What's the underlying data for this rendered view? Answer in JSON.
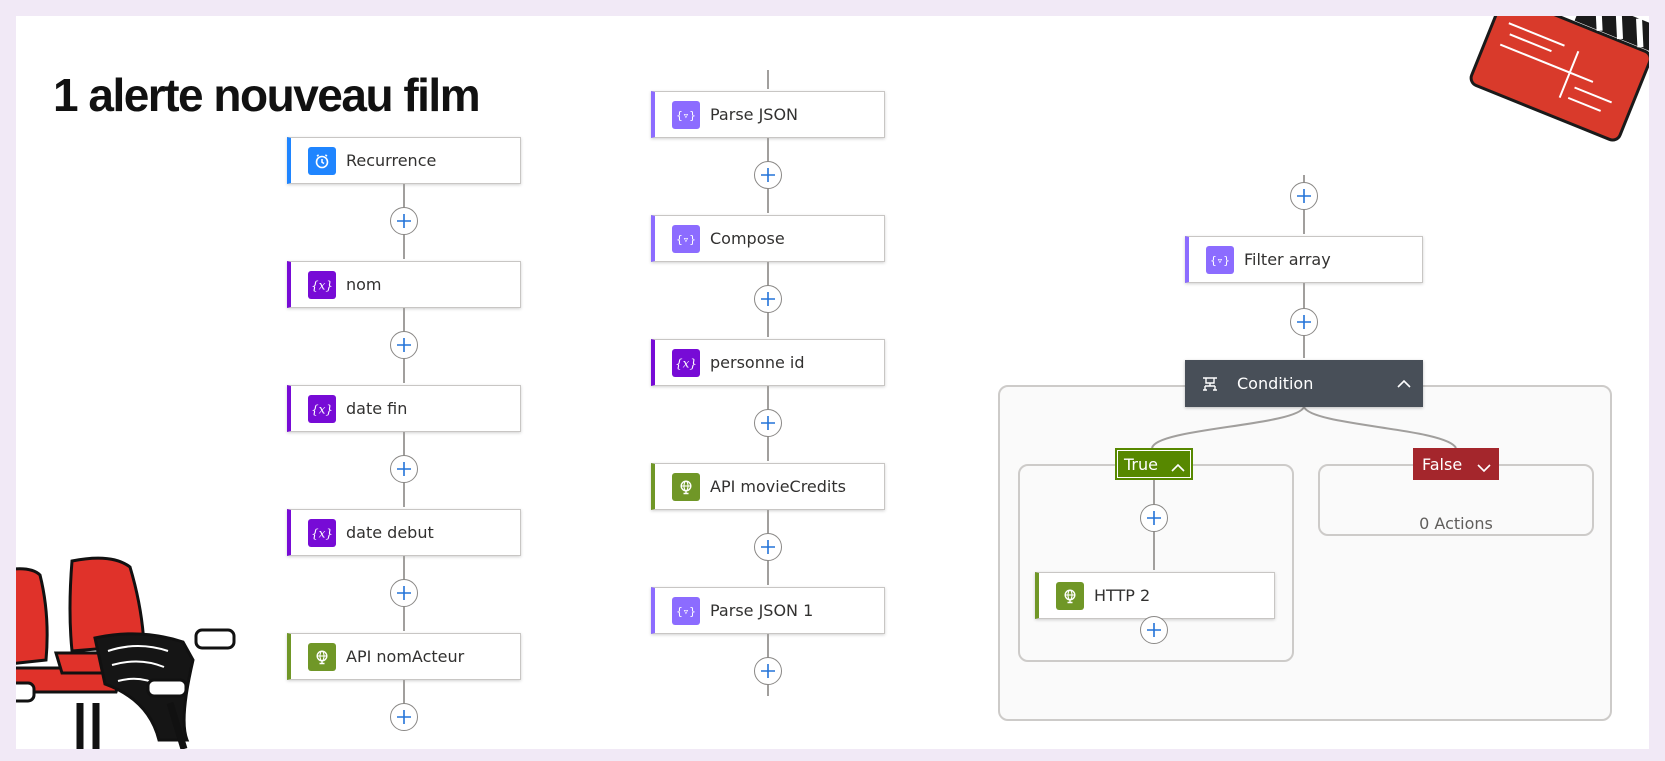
{
  "slide": {
    "title": "1 alerte nouveau film"
  },
  "flow_left": {
    "steps": [
      {
        "label": "Recurrence",
        "icon": "clock-icon",
        "accent": "#1f85ff"
      },
      {
        "label": "nom",
        "icon": "variable-icon",
        "accent": "#770bd6"
      },
      {
        "label": "date fin",
        "icon": "variable-icon",
        "accent": "#770bd6"
      },
      {
        "label": "date debut",
        "icon": "variable-icon",
        "accent": "#770bd6"
      },
      {
        "label": "API nomActeur",
        "icon": "globe-icon",
        "accent": "#709727"
      }
    ]
  },
  "flow_middle": {
    "steps": [
      {
        "label": "Parse JSON",
        "icon": "data-operation-icon",
        "accent": "#8c6cff"
      },
      {
        "label": "Compose",
        "icon": "data-operation-icon",
        "accent": "#8c6cff"
      },
      {
        "label": "personne id",
        "icon": "variable-icon",
        "accent": "#770bd6"
      },
      {
        "label": "API movieCredits",
        "icon": "globe-icon",
        "accent": "#709727"
      },
      {
        "label": "Parse JSON 1",
        "icon": "data-operation-icon",
        "accent": "#8c6cff"
      }
    ]
  },
  "flow_right": {
    "filter": {
      "label": "Filter array",
      "icon": "data-operation-icon",
      "accent": "#8c6cff"
    },
    "condition": {
      "label": "Condition",
      "icon": "condition-icon",
      "color": "#484f58"
    },
    "true_branch": {
      "label": "True",
      "color": "#578800",
      "action": {
        "label": "HTTP 2",
        "icon": "globe-icon",
        "accent": "#709727"
      }
    },
    "false_branch": {
      "label": "False",
      "color": "#a4262c",
      "empty_text": "0 Actions"
    }
  }
}
